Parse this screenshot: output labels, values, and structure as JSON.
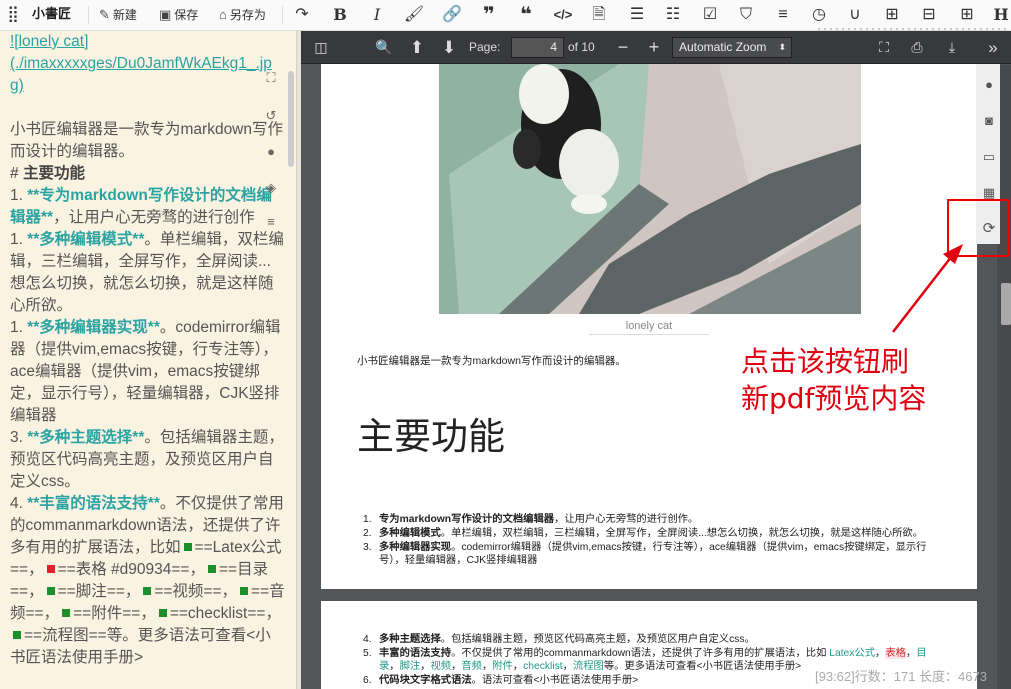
{
  "toolbar": {
    "logo": "小書匠",
    "new_label": "新建",
    "save_label": "保存",
    "save_as_label": "另存为"
  },
  "editor": {
    "lines": {
      "img_link_1": "![lonely cat]",
      "img_link_2": "(./imaxxxxxges/Du0JamfWkAEkg1_.jp",
      "img_link_3": "g)",
      "intro": "小书匠编辑器是一款专为markdown写作而设计的编辑器。",
      "heading_mark": "# ",
      "heading": "主要功能",
      "item1_prefix": "1. ",
      "item1_bold": "**专为markdown写作设计的文档编辑器**",
      "item1_rest": "，让用户心无旁骛的进行创作",
      "item2_prefix": "1. ",
      "item2_bold": "**多种编辑模式**",
      "item2_rest": "。单栏编辑，双栏编辑，三栏编辑，全屏写作，全屏阅读...想怎么切换，就怎么切换，就是这样随心所欲。",
      "item3_prefix": "1. ",
      "item3_bold": "**多种编辑器实现**",
      "item3_rest": "。codemirror编辑器（提供vim,emacs按键，行专注等），ace编辑器（提供vim，emacs按键绑定，显示行号），轻量编辑器，CJK竖排编辑器",
      "item4_prefix": "3. ",
      "item4_bold": "**多种主题选择**",
      "item4_rest": "。包括编辑器主题，预览区代码高亮主题，及预览区用户自定义css。",
      "item5_prefix": "4. ",
      "item5_bold": "**丰富的语法支持**",
      "item5_a": "。不仅提供了常用的commanmarkdown语法，还提供了许多有用的扩展语法，比如",
      "item5_b": "==Latex公式==，",
      "item5_c": "==表格 #d90934==，",
      "item5_d": "==目录==，",
      "item5_e": "==脚注==，",
      "item5_f": "==视频==，",
      "item5_g": "==音频==，",
      "item5_h": "==附件==，",
      "item5_i": "==checklist==，",
      "item5_j": "==流程图==等。更多语法可查看<小书匠语法使用手册>"
    }
  },
  "pdf": {
    "page_label": "Page:",
    "page_value": "4",
    "page_total": "of 10",
    "zoom": "Automatic Zoom",
    "caption": "lonely cat",
    "intro": "小书匠编辑器是一款专为markdown写作而设计的编辑器。",
    "heading": "主要功能",
    "list1": [
      {
        "num": "1.",
        "bold": "专为markdown写作设计的文档编辑器",
        "rest": "，让用户心无旁骛的进行创作。"
      },
      {
        "num": "2.",
        "bold": "多种编辑模式",
        "rest": "。单栏编辑，双栏编辑，三栏编辑，全屏写作，全屏阅读...想怎么切换，就怎么切换，就是这样随心所欲。"
      },
      {
        "num": "3.",
        "bold": "多种编辑器实现",
        "rest": "。codemirror编辑器（提供vim,emacs按键，行专注等），ace编辑器（提供vim，emacs按键绑定，显示行号），轻量编辑器，CJK竖排编辑器"
      }
    ],
    "list2": {
      "i4_num": "4.",
      "i4_bold": "多种主题选择",
      "i4_rest": "。包括编辑器主题，预览区代码高亮主题，及预览区用户自定义css。",
      "i5_num": "5.",
      "i5_bold": "丰富的语法支持",
      "i5_a": "。不仅提供了常用的commanmarkdown语法，还提供了许多有用的扩展语法，比如 ",
      "i5_latex": "Latex公式",
      "i5_sep1": "，",
      "i5_table": "表格",
      "i5_sep2": "，",
      "i5_toc": "目录",
      "i5_sep3": "，",
      "i5_fn": "脚注",
      "i5_sep4": "，",
      "i5_video": "视频",
      "i5_sep5": "，",
      "i5_audio": "音频",
      "i5_sep6": "，",
      "i5_att": "附件",
      "i5_sep7": "，",
      "i5_check": "checklist",
      "i5_sep8": "，",
      "i5_flow": "流程图",
      "i5_end": "等。更多语法可查看<小书匠语法使用手册>",
      "i6_num": "6.",
      "i6_bold": "代码块文字格式语法",
      "i6_rest": "。语法可查看<小书匠语法使用手册>"
    }
  },
  "annotation": {
    "line1": "点击该按钮刷",
    "line2": "新pdf预览内容",
    "color": "#e00010"
  },
  "status": "[93:62]行数：171 长度：4673",
  "colors": {
    "accent": "#2aa3a3",
    "editor_bg": "#fbf3e1",
    "pdf_bg": "#525659"
  }
}
